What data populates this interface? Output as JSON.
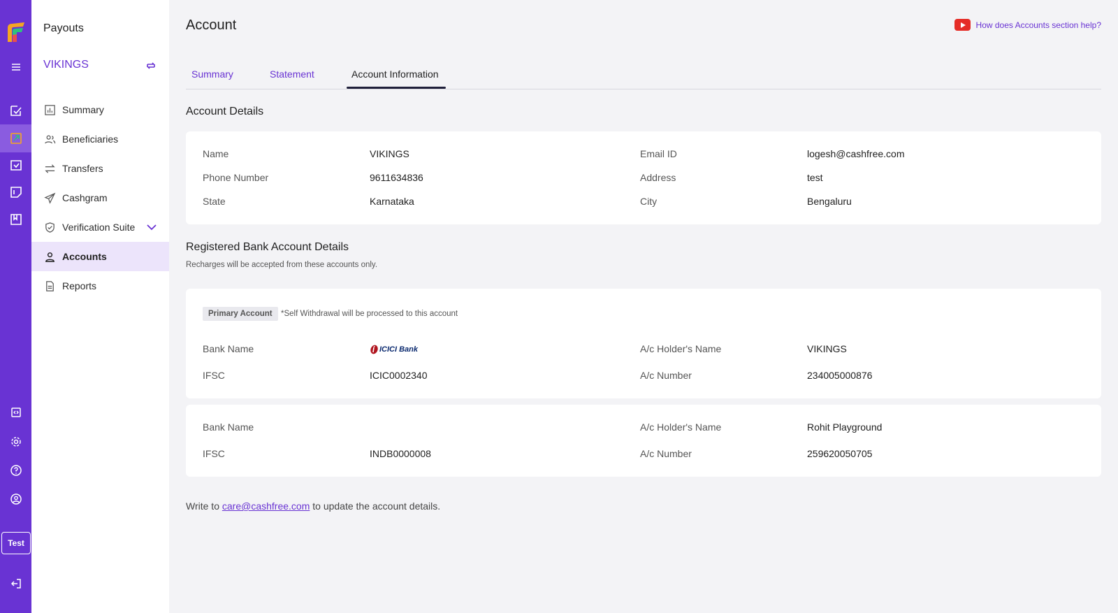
{
  "rail": {
    "test_label": "Test"
  },
  "sidebar": {
    "app_title": "Payouts",
    "merchant_name": "VIKINGS",
    "items": [
      {
        "label": "Summary",
        "icon": "chart-icon"
      },
      {
        "label": "Beneficiaries",
        "icon": "users-icon"
      },
      {
        "label": "Transfers",
        "icon": "transfer-icon"
      },
      {
        "label": "Cashgram",
        "icon": "send-icon"
      },
      {
        "label": "Verification Suite",
        "icon": "shield-check-icon"
      },
      {
        "label": "Accounts",
        "icon": "user-icon"
      },
      {
        "label": "Reports",
        "icon": "document-icon"
      }
    ]
  },
  "header": {
    "title": "Account",
    "help_text": "How does Accounts section help?"
  },
  "tabs": {
    "summary": "Summary",
    "statement": "Statement",
    "account_information": "Account Information"
  },
  "account_details": {
    "title": "Account Details",
    "name_label": "Name",
    "name_value": "VIKINGS",
    "phone_label": "Phone Number",
    "phone_value": "9611634836",
    "state_label": "State",
    "state_value": "Karnataka",
    "email_label": "Email ID",
    "email_value": "logesh@cashfree.com",
    "address_label": "Address",
    "address_value": "test",
    "city_label": "City",
    "city_value": "Bengaluru"
  },
  "bank_details": {
    "title": "Registered Bank Account Details",
    "subtitle": "Recharges will be accepted from these accounts only.",
    "primary_badge": "Primary Account",
    "primary_note": "*Self Withdrawal will be processed to this account",
    "accounts": [
      {
        "bank_name_label": "Bank Name",
        "bank_logo_text": "ICICI Bank",
        "ifsc_label": "IFSC",
        "ifsc_value": "ICIC0002340",
        "holder_label": "A/c Holder's Name",
        "holder_value": "VIKINGS",
        "number_label": "A/c Number",
        "number_value": "234005000876"
      },
      {
        "bank_name_label": "Bank Name",
        "ifsc_label": "IFSC",
        "ifsc_value": "INDB0000008",
        "holder_label": "A/c Holder's Name",
        "holder_value": "Rohit Playground",
        "number_label": "A/c Number",
        "number_value": "259620050705"
      }
    ]
  },
  "footer": {
    "prefix": "Write to",
    "email": "care@cashfree.com",
    "suffix": "to update the account details."
  }
}
